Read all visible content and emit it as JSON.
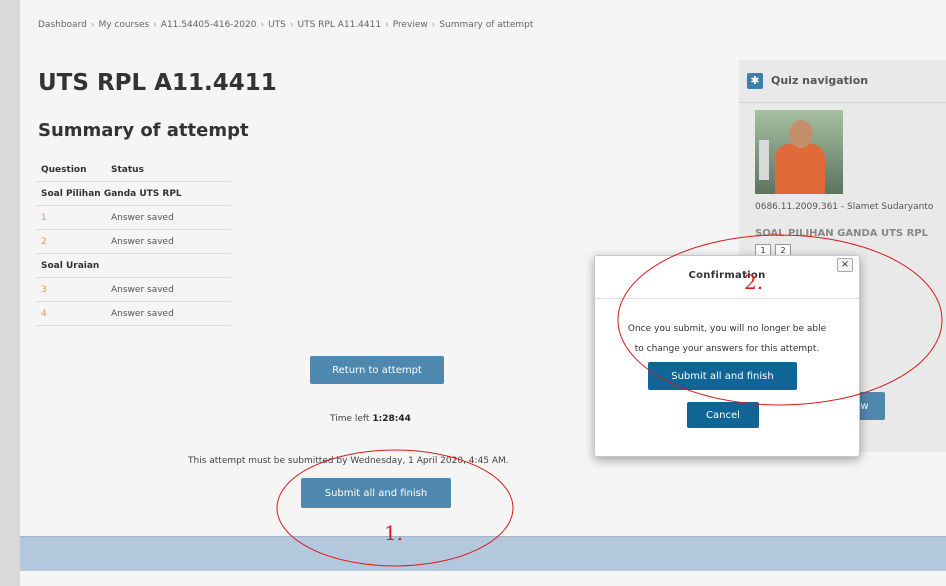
{
  "breadcrumb": [
    "Dashboard",
    "My courses",
    "A11.54405-416-2020",
    "UTS",
    "UTS RPL A11.4411",
    "Preview",
    "Summary of attempt"
  ],
  "breadcrumb_separator": "›",
  "course_title": "UTS RPL A11.4411",
  "summary_title": "Summary of attempt",
  "table": {
    "headers": {
      "question": "Question",
      "status": "Status"
    },
    "sections": [
      {
        "title": "Soal Pilihan Ganda UTS RPL",
        "rows": [
          {
            "q": "1",
            "status": "Answer saved"
          },
          {
            "q": "2",
            "status": "Answer saved"
          }
        ]
      },
      {
        "title": "Soal Uraian",
        "rows": [
          {
            "q": "3",
            "status": "Answer saved"
          },
          {
            "q": "4",
            "status": "Answer saved"
          }
        ]
      }
    ]
  },
  "return_button": "Return to attempt",
  "time_left": {
    "label": "Time left ",
    "value": "1:28:44"
  },
  "deadline_text": "This attempt must be submitted by Wednesday, 1 April 2020, 4:45 AM.",
  "submit_button": "Submit all and finish",
  "quiz_nav": {
    "icon": "puzzle-icon",
    "title": "Quiz navigation",
    "user_name": "0686.11.2009.361 - Slamet Sudaryanto",
    "section_title": "SOAL PILIHAN GANDA UTS RPL",
    "question_buttons": [
      "1",
      "2"
    ],
    "preview_button": "review"
  },
  "modal": {
    "title": "Confirmation",
    "close_label": "×",
    "body_line1": "Once you submit, you will no longer be able",
    "body_line2": "to change your answers for this attempt.",
    "submit_button": "Submit all and finish",
    "cancel_button": "Cancel"
  },
  "annotations": {
    "label1": "1.",
    "label2": "2.",
    "color": "#d81b1b"
  },
  "colors": {
    "button": "#4e88ae",
    "button_dark": "#0f6595",
    "question_link": "#e8954e",
    "footer": "#b3c8dd"
  }
}
